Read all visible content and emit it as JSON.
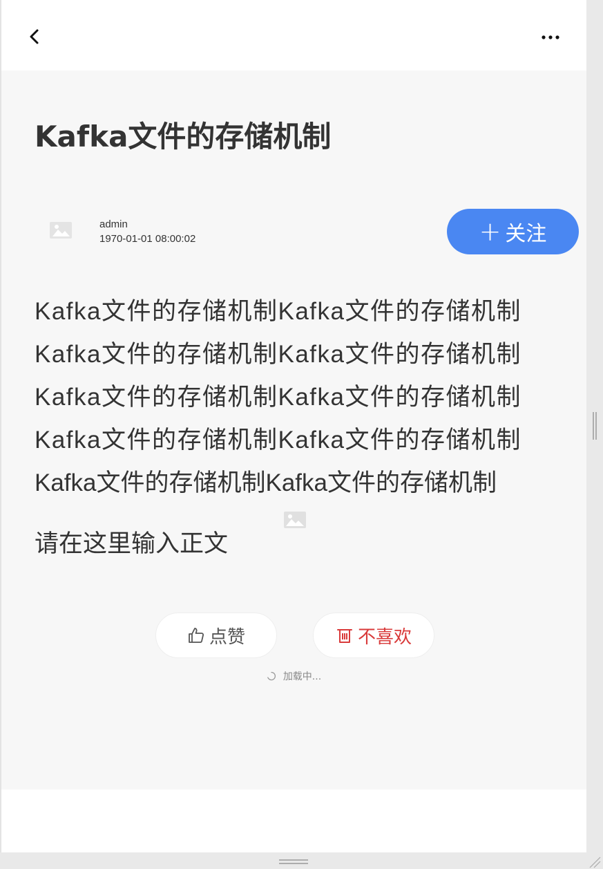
{
  "header": {
    "back_icon": "chevron-left-icon",
    "more_icon": "more-horizontal-icon"
  },
  "article": {
    "title": "Kafka文件的存储机制",
    "author": {
      "name": "admin",
      "time": "1970-01-01 08:00:02",
      "avatar_icon": "image-placeholder-icon"
    },
    "follow_label": "关注",
    "follow_icon": "plus-icon",
    "body_lines": [
      "Kafka文件的存储机制Kafka文件的存储机制",
      "Kafka文件的存储机制Kafka文件的存储机制",
      "Kafka文件的存储机制Kafka文件的存储机制",
      "Kafka文件的存储机制Kafka文件的存储机制",
      "Kafka文件的存储机制Kafka文件的存储机制"
    ],
    "image_icon": "image-placeholder-icon",
    "body_text": "请在这里输入正文"
  },
  "actions": {
    "like_label": "点赞",
    "like_icon": "thumbs-up-icon",
    "dislike_label": "不喜欢",
    "dislike_icon": "trash-icon"
  },
  "status": {
    "loading_text": "加载中..."
  },
  "colors": {
    "accent": "#4a87f2",
    "danger": "#d93a3a",
    "content_bg": "#f7f7f7"
  }
}
